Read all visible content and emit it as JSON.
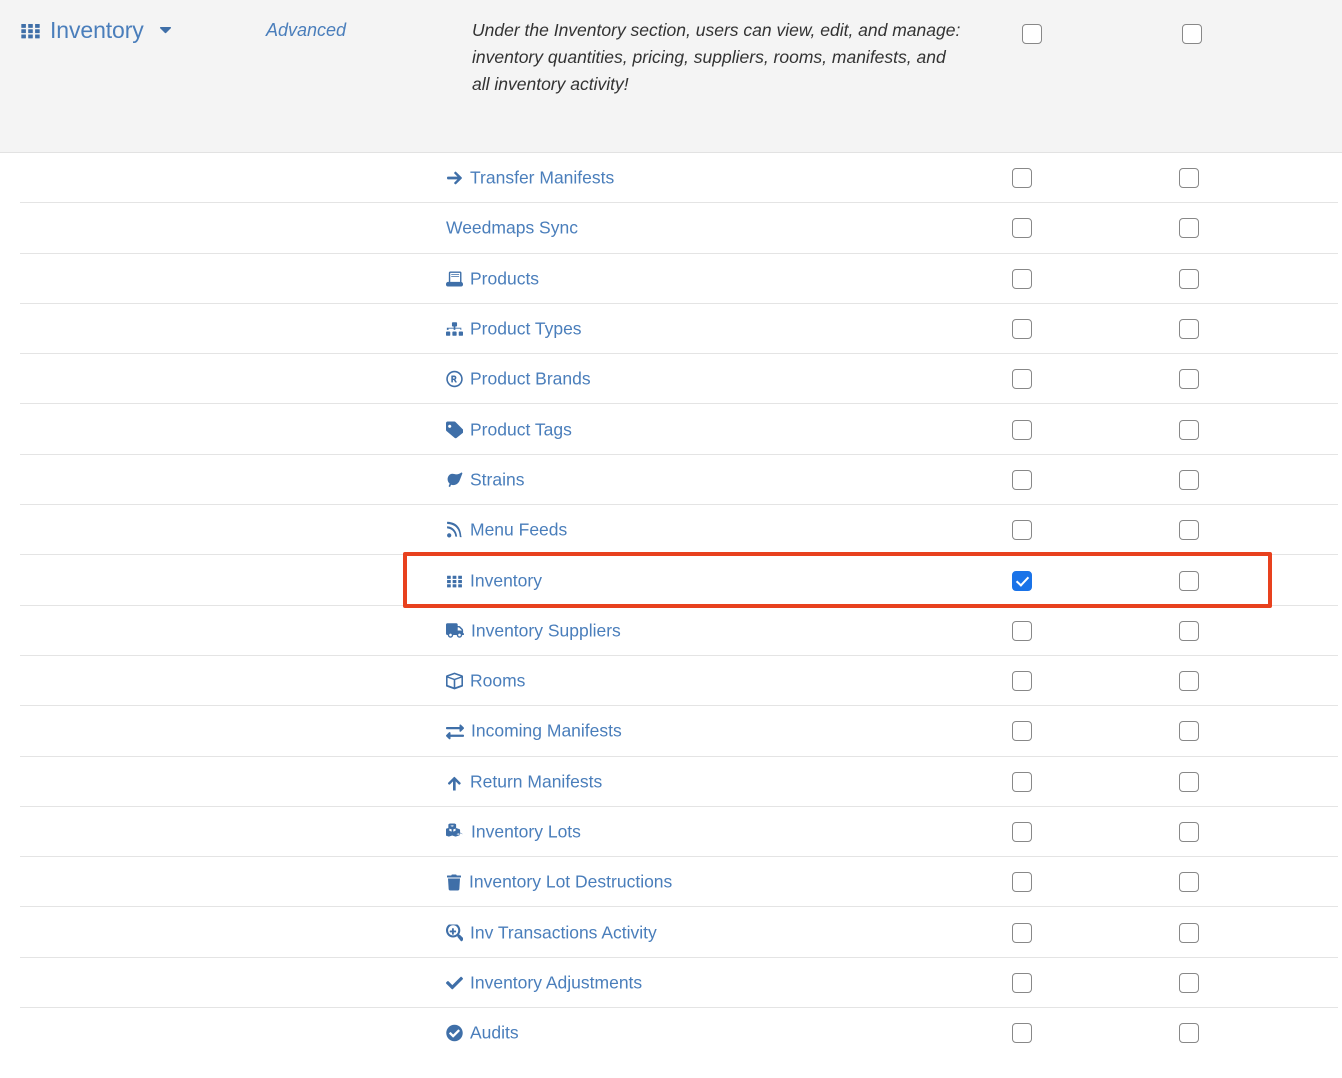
{
  "section_header": {
    "icon": "th-grid-icon",
    "title": "Inventory",
    "caret_icon": "chevron-down-icon",
    "advanced_label": "Advanced",
    "description": "Under the Inventory section, users can view, edit, and manage: inventory quantities, pricing, suppliers, rooms, manifests, and all inventory activity!",
    "column_1_checked": false,
    "column_2_checked": false
  },
  "colors": {
    "link_blue": "#4a7ebb",
    "icon_blue": "#3f6fa8",
    "checkbox_checked": "#1a73e8",
    "header_band": "#f4f4f4",
    "row_divider": "#e4e4e4",
    "highlight": "#e8411e",
    "description_text": "#333333"
  },
  "highlight": {
    "target_row_index": 8,
    "note": "red annotation rectangle around the Inventory row"
  },
  "rows": [
    {
      "icon": "arrow-right-icon",
      "label": "Transfer Manifests",
      "col1": false,
      "col2": false
    },
    {
      "icon": "none",
      "label": "Weedmaps Sync",
      "col1": false,
      "col2": false
    },
    {
      "icon": "book-icon",
      "label": "Products",
      "col1": false,
      "col2": false
    },
    {
      "icon": "sitemap-icon",
      "label": "Product Types",
      "col1": false,
      "col2": false
    },
    {
      "icon": "registered-icon",
      "label": "Product Brands",
      "col1": false,
      "col2": false
    },
    {
      "icon": "tag-icon",
      "label": "Product Tags",
      "col1": false,
      "col2": false
    },
    {
      "icon": "leaf-icon",
      "label": "Strains",
      "col1": false,
      "col2": false
    },
    {
      "icon": "rss-icon",
      "label": "Menu Feeds",
      "col1": false,
      "col2": false
    },
    {
      "icon": "th-grid-icon",
      "label": "Inventory",
      "col1": true,
      "col2": false
    },
    {
      "icon": "truck-icon",
      "label": "Inventory Suppliers",
      "col1": false,
      "col2": false
    },
    {
      "icon": "cube-icon",
      "label": "Rooms",
      "col1": false,
      "col2": false
    },
    {
      "icon": "exchange-icon",
      "label": "Incoming Manifests",
      "col1": false,
      "col2": false
    },
    {
      "icon": "arrow-up-icon",
      "label": "Return Manifests",
      "col1": false,
      "col2": false
    },
    {
      "icon": "cubes-icon",
      "label": "Inventory Lots",
      "col1": false,
      "col2": false
    },
    {
      "icon": "trash-icon",
      "label": "Inventory Lot Destructions",
      "col1": false,
      "col2": false
    },
    {
      "icon": "search-plus-icon",
      "label": "Inv Transactions Activity",
      "col1": false,
      "col2": false
    },
    {
      "icon": "check-icon",
      "label": "Inventory Adjustments",
      "col1": false,
      "col2": false
    },
    {
      "icon": "check-circle-icon",
      "label": "Audits",
      "col1": false,
      "col2": false
    }
  ]
}
